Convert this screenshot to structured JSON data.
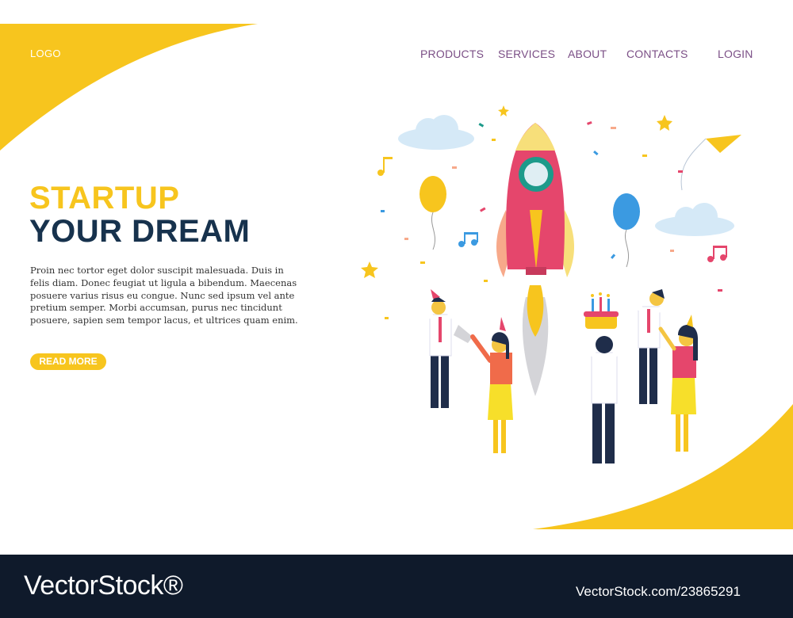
{
  "header": {
    "logo": "LOGO",
    "nav": {
      "products": "PRODUCTS",
      "services": "SERVICES",
      "about": "ABOUT",
      "contacts": "CONTACTS",
      "login": "LOGIN"
    }
  },
  "hero": {
    "title_line1": "STARTUP",
    "title_line2": "YOUR DREAM",
    "body": "Proin nec tortor eget dolor suscipit malesuada. Duis in felis diam. Donec feugiat ut ligula a bibendum. Maecenas posuere varius risus eu congue. Nunc sed ipsum vel ante pretium semper. Morbi accumsan, purus nec tincidunt posuere, sapien sem tempor lacus, et ultrices quam enim.",
    "cta": "READ MORE"
  },
  "footer": {
    "watermark_left": "VectorStock®",
    "watermark_right": "VectorStock.com/23865291"
  },
  "colors": {
    "accent_yellow": "#f7c51e",
    "navy": "#17324d",
    "nav_purple": "#7b4f86",
    "rocket_pink": "#e5466c",
    "footer_bg": "#0f1a2b"
  },
  "illustration": {
    "icons": [
      "rocket-icon",
      "balloon-icon",
      "cloud-icon",
      "music-note-icon",
      "star-icon",
      "paper-plane-icon",
      "birthday-cake-icon",
      "megaphone-icon",
      "confetti"
    ]
  }
}
